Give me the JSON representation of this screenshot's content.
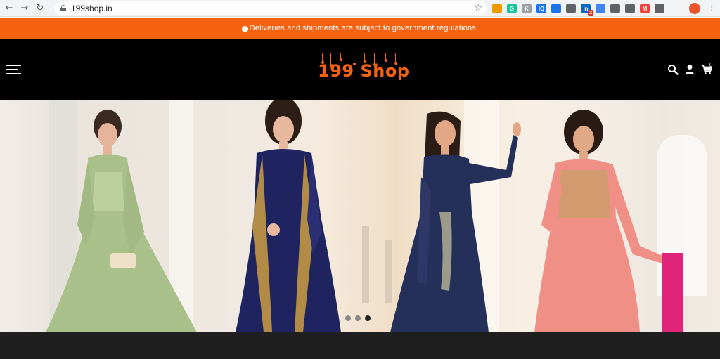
{
  "browser": {
    "url": "199shop.in",
    "back_icon": "arrow-left-icon",
    "forward_icon": "arrow-right-icon",
    "reload_icon": "reload-icon",
    "extensions": [
      {
        "name": "extension-bars-icon",
        "color": "#f29900",
        "text": ""
      },
      {
        "name": "extension-grammarly-icon",
        "color": "#15c39a",
        "text": "G"
      },
      {
        "name": "extension-k-icon",
        "color": "#9aa0a6",
        "text": "K"
      },
      {
        "name": "extension-iq-icon",
        "color": "#1a73e8",
        "text": "IQ"
      },
      {
        "name": "extension-translate-icon",
        "color": "#1a73e8",
        "text": ""
      },
      {
        "name": "extension-code-icon",
        "color": "#5f6368",
        "text": ""
      },
      {
        "name": "extension-linkedin-icon",
        "color": "#0a66c2",
        "text": "in",
        "badge": "2"
      },
      {
        "name": "extension-monitor-icon",
        "color": "#4285f4",
        "text": ""
      },
      {
        "name": "extension-cloud-icon",
        "color": "#5f6368",
        "text": ""
      },
      {
        "name": "extension-gear-icon",
        "color": "#5f6368",
        "text": ""
      },
      {
        "name": "extension-m-icon",
        "color": "#ea4335",
        "text": "M"
      },
      {
        "name": "extension-puzzle-icon",
        "color": "#5f6368",
        "text": ""
      }
    ]
  },
  "announcement": {
    "text": "Deliveries and shipments are subject to government regulations."
  },
  "header": {
    "logo_text": "199 Shop",
    "cart_count": "0",
    "icons": [
      "menu-icon",
      "search-icon",
      "user-icon",
      "cart-icon"
    ]
  },
  "colors": {
    "brand_orange": "#f4620f",
    "header_bg": "#000000"
  },
  "hero": {
    "slides": 3,
    "active_slide": 3,
    "models": [
      {
        "name": "model-mint-green-gown",
        "color": "#a9c08a"
      },
      {
        "name": "model-navy-embroidered-gown",
        "color": "#1f2460"
      },
      {
        "name": "model-navy-anarkali",
        "color": "#25305a"
      },
      {
        "name": "model-pink-anarkali",
        "color": "#ef8f86"
      }
    ]
  }
}
